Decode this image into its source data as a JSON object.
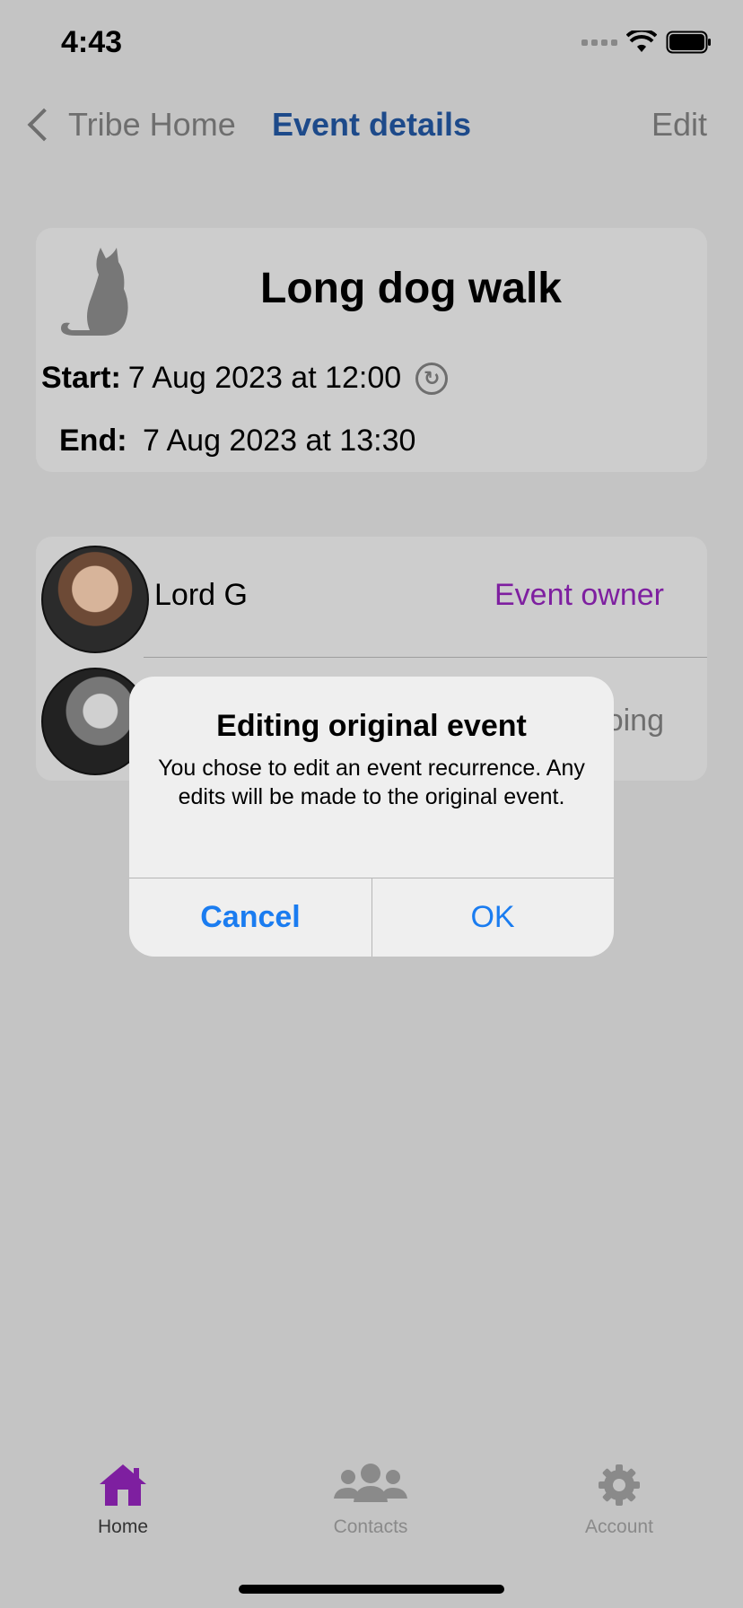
{
  "status_bar": {
    "time": "4:43"
  },
  "nav": {
    "back_label": "Tribe Home",
    "title": "Event details",
    "edit_label": "Edit"
  },
  "event": {
    "title": "Long dog walk",
    "start_label": "Start:",
    "start_value": "7 Aug 2023 at 12:00",
    "end_label": "End:",
    "end_value": "7 Aug 2023 at 13:30"
  },
  "participants": [
    {
      "name": "Lord G",
      "role": "Event owner"
    },
    {
      "name": "",
      "role": "oing"
    }
  ],
  "alert": {
    "title": "Editing original event",
    "message": "You chose to edit an event recurrence. Any edits will be made to the original event.",
    "cancel_label": "Cancel",
    "ok_label": "OK"
  },
  "tab_bar": {
    "items": [
      {
        "label": "Home",
        "icon": "home-icon",
        "active": true
      },
      {
        "label": "Contacts",
        "icon": "contacts-icon",
        "active": false
      },
      {
        "label": "Account",
        "icon": "gear-icon",
        "active": false
      }
    ]
  },
  "colors": {
    "accent": "#7e1fa0",
    "title_blue": "#1d4a8a",
    "alert_button": "#1a7cf0",
    "background": "#c4c4c4"
  }
}
